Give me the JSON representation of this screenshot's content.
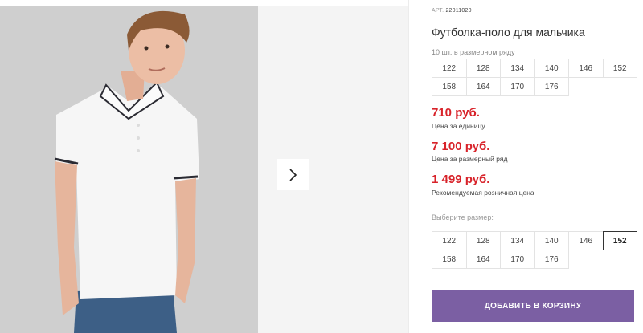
{
  "product": {
    "sku_label": "АРТ.",
    "sku_value": "22011020",
    "title": "Футболка-поло для мальчика",
    "range_note": "10 шт. в размерном ряду",
    "range_sizes": [
      "122",
      "128",
      "134",
      "140",
      "146",
      "152",
      "158",
      "164",
      "170",
      "176"
    ]
  },
  "prices": [
    {
      "amount": "710 руб.",
      "label": "Цена за единицу"
    },
    {
      "amount": "7 100 руб.",
      "label": "Цена за размерный ряд"
    },
    {
      "amount": "1 499 руб.",
      "label": "Рекомендуемая розничная цена"
    }
  ],
  "size_picker": {
    "label": "Выберите размер:",
    "options": [
      "122",
      "128",
      "134",
      "140",
      "146",
      "152",
      "158",
      "164",
      "170",
      "176"
    ],
    "selected": "152"
  },
  "cart_button": "ДОБАВИТЬ В КОРЗИНУ",
  "colors": {
    "accent": "#7b5fa3",
    "price": "#d8232a"
  },
  "gallery": {
    "next_icon": "chevron-right-icon"
  }
}
